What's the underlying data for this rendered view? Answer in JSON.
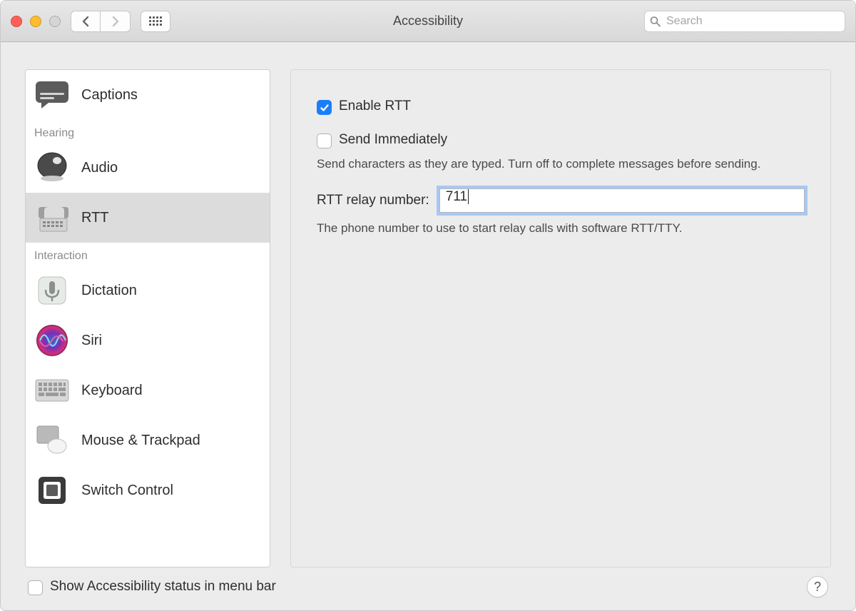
{
  "window": {
    "title": "Accessibility",
    "search_placeholder": "Search"
  },
  "sidebar": {
    "items": [
      {
        "label": "Captions",
        "section": null
      },
      {
        "label": "Audio",
        "section": "Hearing"
      },
      {
        "label": "RTT",
        "section": null,
        "selected": true
      },
      {
        "label": "Dictation",
        "section": "Interaction"
      },
      {
        "label": "Siri",
        "section": null
      },
      {
        "label": "Keyboard",
        "section": null
      },
      {
        "label": "Mouse & Trackpad",
        "section": null
      },
      {
        "label": "Switch Control",
        "section": null
      }
    ],
    "section_hearing": "Hearing",
    "section_interaction": "Interaction"
  },
  "main": {
    "enable_rtt_label": "Enable RTT",
    "enable_rtt_checked": true,
    "send_immediately_label": "Send Immediately",
    "send_immediately_checked": false,
    "send_immediately_help": "Send characters as they are typed. Turn off to complete messages before sending.",
    "relay_label": "RTT relay number:",
    "relay_value": "711",
    "relay_help": "The phone number to use to start relay calls with software RTT/TTY."
  },
  "footer": {
    "show_status_label": "Show Accessibility status in menu bar",
    "show_status_checked": false,
    "help_label": "?"
  }
}
